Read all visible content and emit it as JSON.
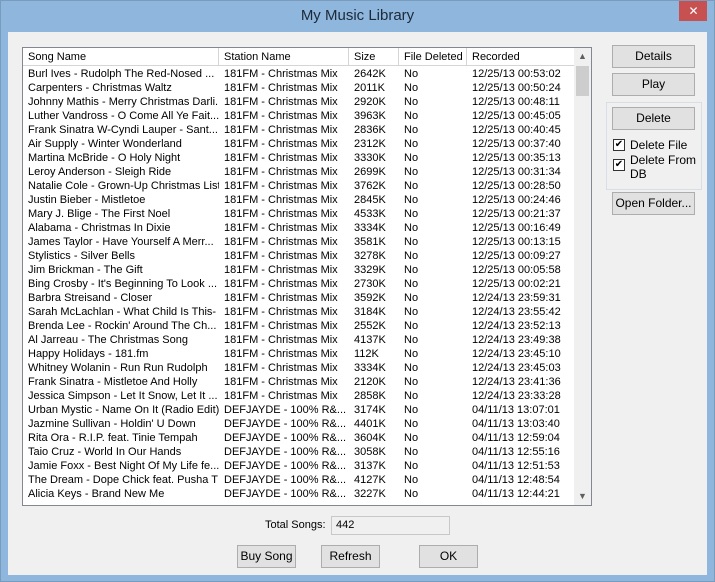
{
  "window": {
    "title": "My Music Library",
    "close_glyph": "✕"
  },
  "list": {
    "columns": [
      "Song Name",
      "Station Name",
      "Size",
      "File Deleted",
      "Recorded"
    ],
    "rows": [
      [
        "Burl Ives - Rudolph The Red-Nosed ...",
        "181FM - Christmas Mix",
        "2642K",
        "No",
        "12/25/13 00:53:02"
      ],
      [
        "Carpenters - Christmas Waltz",
        "181FM - Christmas Mix",
        "2011K",
        "No",
        "12/25/13 00:50:24"
      ],
      [
        "Johnny Mathis - Merry Christmas Darli...",
        "181FM - Christmas Mix",
        "2920K",
        "No",
        "12/25/13 00:48:11"
      ],
      [
        "Luther Vandross - O Come All Ye Fait...",
        "181FM - Christmas Mix",
        "3963K",
        "No",
        "12/25/13 00:45:05"
      ],
      [
        "Frank Sinatra W-Cyndi Lauper - Sant...",
        "181FM - Christmas Mix",
        "2836K",
        "No",
        "12/25/13 00:40:45"
      ],
      [
        "Air Supply - Winter Wonderland",
        "181FM - Christmas Mix",
        "2312K",
        "No",
        "12/25/13 00:37:40"
      ],
      [
        "Martina McBride - O Holy Night",
        "181FM - Christmas Mix",
        "3330K",
        "No",
        "12/25/13 00:35:13"
      ],
      [
        "Leroy Anderson - Sleigh Ride",
        "181FM - Christmas Mix",
        "2699K",
        "No",
        "12/25/13 00:31:34"
      ],
      [
        "Natalie Cole - Grown-Up Christmas List",
        "181FM - Christmas Mix",
        "3762K",
        "No",
        "12/25/13 00:28:50"
      ],
      [
        "Justin Bieber - Mistletoe",
        "181FM - Christmas Mix",
        "2845K",
        "No",
        "12/25/13 00:24:46"
      ],
      [
        "Mary J. Blige - The First Noel",
        "181FM - Christmas Mix",
        "4533K",
        "No",
        "12/25/13 00:21:37"
      ],
      [
        "Alabama - Christmas In Dixie",
        "181FM - Christmas Mix",
        "3334K",
        "No",
        "12/25/13 00:16:49"
      ],
      [
        "James Taylor - Have Yourself A Merr...",
        "181FM - Christmas Mix",
        "3581K",
        "No",
        "12/25/13 00:13:15"
      ],
      [
        "Stylistics - Silver Bells",
        "181FM - Christmas Mix",
        "3278K",
        "No",
        "12/25/13 00:09:27"
      ],
      [
        "Jim Brickman - The Gift",
        "181FM - Christmas Mix",
        "3329K",
        "No",
        "12/25/13 00:05:58"
      ],
      [
        "Bing Crosby - It's Beginning To Look ...",
        "181FM - Christmas Mix",
        "2730K",
        "No",
        "12/25/13 00:02:21"
      ],
      [
        "Barbra Streisand - Closer",
        "181FM - Christmas Mix",
        "3592K",
        "No",
        "12/24/13 23:59:31"
      ],
      [
        "Sarah McLachlan - What Child Is This-",
        "181FM - Christmas Mix",
        "3184K",
        "No",
        "12/24/13 23:55:42"
      ],
      [
        "Brenda Lee - Rockin' Around The Ch...",
        "181FM - Christmas Mix",
        "2552K",
        "No",
        "12/24/13 23:52:13"
      ],
      [
        "Al Jarreau - The Christmas Song",
        "181FM - Christmas Mix",
        "4137K",
        "No",
        "12/24/13 23:49:38"
      ],
      [
        "Happy Holidays - 181.fm",
        "181FM - Christmas Mix",
        "112K",
        "No",
        "12/24/13 23:45:10"
      ],
      [
        "Whitney Wolanin - Run Run Rudolph",
        "181FM - Christmas Mix",
        "3334K",
        "No",
        "12/24/13 23:45:03"
      ],
      [
        "Frank Sinatra - Mistletoe And Holly",
        "181FM - Christmas Mix",
        "2120K",
        "No",
        "12/24/13 23:41:36"
      ],
      [
        "Jessica Simpson - Let It Snow, Let It ...",
        "181FM - Christmas Mix",
        "2858K",
        "No",
        "12/24/13 23:33:28"
      ],
      [
        "Urban Mystic - Name On It (Radio Edit)",
        "DEFJAYDE - 100% R&...",
        "3174K",
        "No",
        "04/11/13 13:07:01"
      ],
      [
        "Jazmine Sullivan - Holdin' U Down",
        "DEFJAYDE - 100% R&...",
        "4401K",
        "No",
        "04/11/13 13:03:40"
      ],
      [
        "Rita Ora - R.I.P. feat. Tinie Tempah",
        "DEFJAYDE - 100% R&...",
        "3604K",
        "No",
        "04/11/13 12:59:04"
      ],
      [
        "Taio Cruz - World In Our Hands",
        "DEFJAYDE - 100% R&...",
        "3058K",
        "No",
        "04/11/13 12:55:16"
      ],
      [
        "Jamie Foxx - Best Night Of My Life fe...",
        "DEFJAYDE - 100% R&...",
        "3137K",
        "No",
        "04/11/13 12:51:53"
      ],
      [
        "The Dream - Dope Chick feat. Pusha T",
        "DEFJAYDE - 100% R&...",
        "4127K",
        "No",
        "04/11/13 12:48:54"
      ],
      [
        "Alicia Keys - Brand New Me",
        "DEFJAYDE - 100% R&...",
        "3227K",
        "No",
        "04/11/13 12:44:21"
      ]
    ]
  },
  "side": {
    "details": "Details",
    "play": "Play",
    "delete": "Delete",
    "delete_file": "Delete File",
    "delete_from_db_line1": "Delete From",
    "delete_from_db_line2": "DB",
    "check_glyph": "✔",
    "open_folder": "Open Folder..."
  },
  "footer": {
    "total_label": "Total Songs:",
    "total_value": "442",
    "buy_song": "Buy Song",
    "refresh": "Refresh",
    "ok": "OK"
  }
}
